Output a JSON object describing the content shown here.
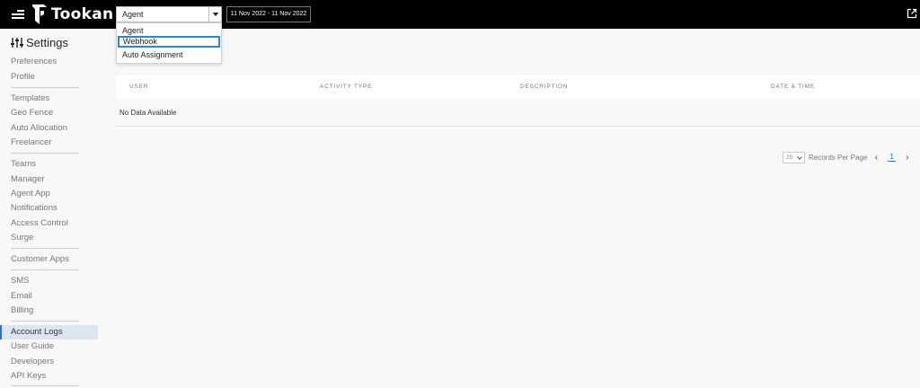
{
  "app": {
    "name": "Tookan"
  },
  "filter": {
    "selected": "Agent",
    "date_range": "11 Nov 2022 - 11 Nov 2022"
  },
  "dropdown": {
    "options": [
      "Agent",
      "Webhook",
      "Auto Assignment"
    ],
    "highlighted": "Webhook"
  },
  "sidebar": {
    "title": "Settings",
    "groups": [
      [
        "Preferences",
        "Profile"
      ],
      [
        "Templates",
        "Geo Fence",
        "Auto Allocation",
        "Freelancer"
      ],
      [
        "Teams",
        "Manager",
        "Agent App",
        "Notifications",
        "Access Control",
        "Surge"
      ],
      [
        "Customer Apps"
      ],
      [
        "SMS",
        "Email",
        "Billing"
      ],
      [
        "Account Logs",
        "User Guide",
        "Developers",
        "API Keys"
      ]
    ],
    "active": "Account Logs"
  },
  "table": {
    "columns": [
      "USER",
      "ACTIVITY TYPE",
      "DESCRIPTION",
      "DATE & TIME"
    ],
    "empty_text": "No Data Available"
  },
  "pagination": {
    "per_page": "25",
    "label": "Records Per Page",
    "current_page": "1"
  },
  "colors": {
    "topbar": "#000000",
    "accent": "#1a73e8",
    "highlight_border": "#2c84d8"
  }
}
